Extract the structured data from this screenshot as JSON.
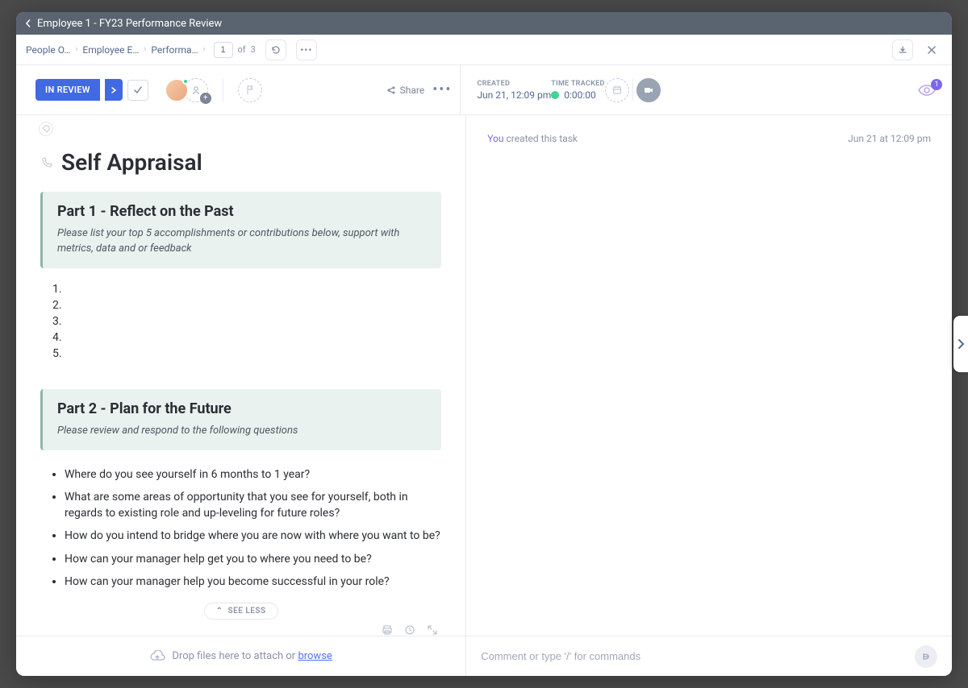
{
  "titlebar": {
    "title": "Employee 1 - FY23 Performance Review"
  },
  "breadcrumb": {
    "items": [
      "People O…",
      "Employee E…",
      "Performa…"
    ],
    "pager": {
      "current": "1",
      "of": "of",
      "total": "3"
    }
  },
  "status": {
    "label": "IN REVIEW"
  },
  "share": {
    "label": "Share"
  },
  "created": {
    "label": "CREATED",
    "value": "Jun 21, 12:09 pm"
  },
  "time_tracked": {
    "label": "TIME TRACKED",
    "value": "0:00:00"
  },
  "watchers": {
    "count": "1"
  },
  "doc": {
    "title": "Self Appraisal",
    "part1": {
      "heading": "Part 1 - Reflect on the Past",
      "prompt": "Please list your top 5 accomplishments or contributions below, support with metrics, data and or feedback"
    },
    "part2": {
      "heading": "Part 2 - Plan for the Future",
      "prompt": "Please review and respond to the following questions",
      "q1": "Where do you see yourself in 6 months to 1 year?",
      "q2": " What are some areas of opportunity that you see for yourself, both in regards to existing role and up-leveling for future roles?",
      "q3": " How do you intend to bridge where you are now with where you want to be?",
      "q4": " How can your manager help get you to where you need to be?",
      "q5": " How can your manager help you become successful in your role?"
    },
    "see_less": "SEE LESS"
  },
  "attach": {
    "prefix": "Drop files here to attach or ",
    "link": "browse"
  },
  "activity": {
    "you": "You",
    "text": " created this task",
    "time": "Jun 21 at 12:09 pm"
  },
  "comment": {
    "placeholder": "Comment or type '/' for commands"
  }
}
